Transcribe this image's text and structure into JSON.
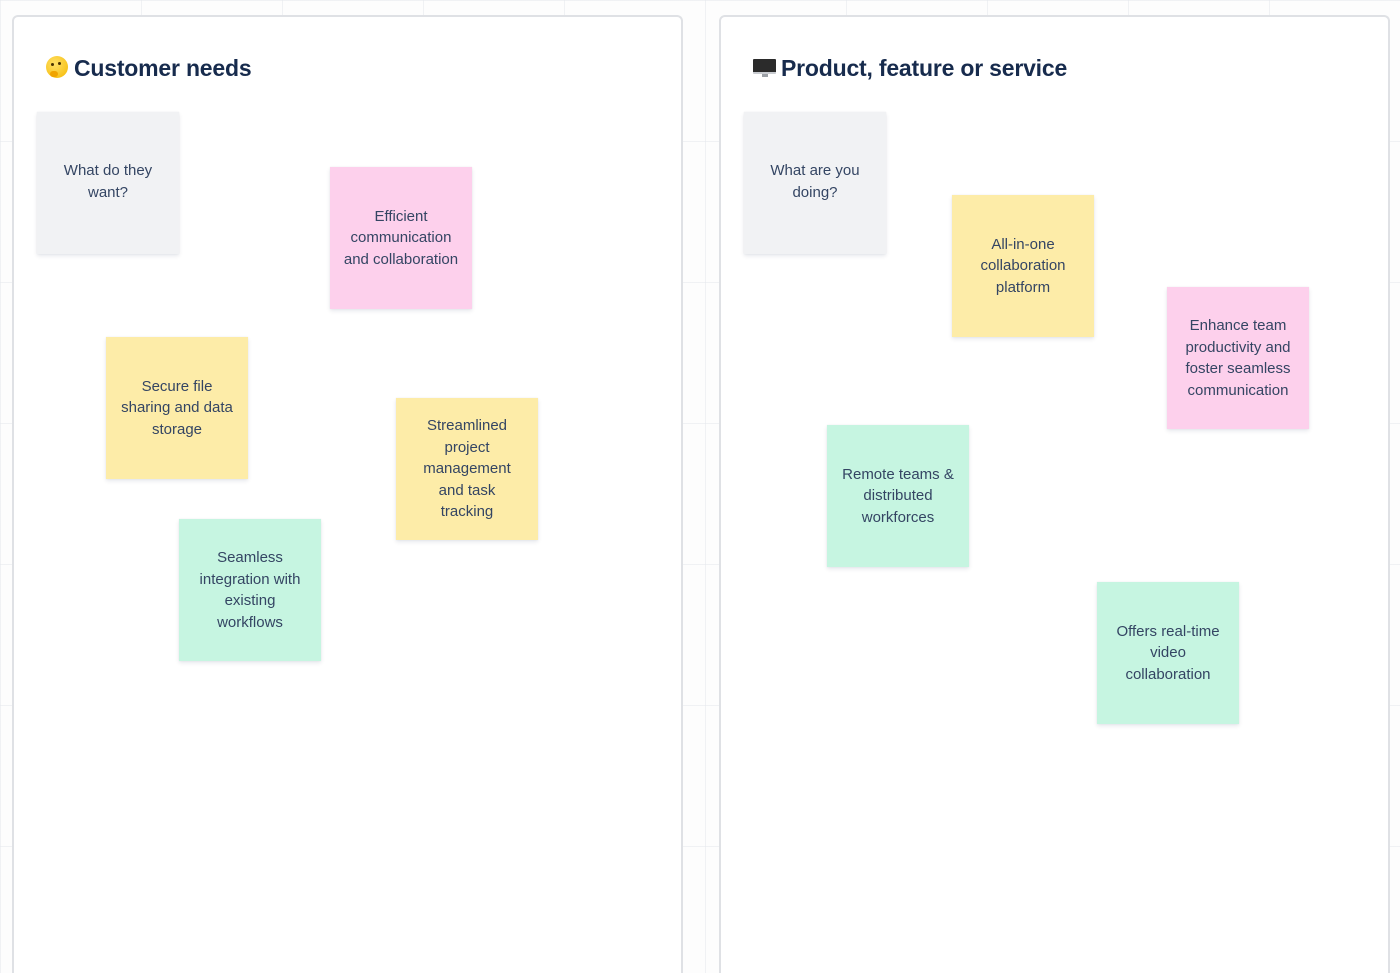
{
  "colors": {
    "gray": "#f1f2f4",
    "pink": "#fdd0ec",
    "yellow": "#fdeca8",
    "green": "#c6f5e1",
    "title_text": "#172b4d",
    "note_text": "#344563",
    "frame_border": "#dfe1e5"
  },
  "frames": [
    {
      "title": "Customer needs",
      "icon": "thinking-face-icon",
      "notes": [
        {
          "text": "What do they want?",
          "color": "gray"
        },
        {
          "text": "Efficient communication and collaboration",
          "color": "pink"
        },
        {
          "text": "Secure file sharing and data storage",
          "color": "yellow"
        },
        {
          "text": "Streamlined project management and task tracking",
          "color": "yellow"
        },
        {
          "text": "Seamless integration with existing workflows",
          "color": "green"
        }
      ]
    },
    {
      "title": "Product, feature or service",
      "icon": "desktop-computer-icon",
      "notes": [
        {
          "text": "What are you doing?",
          "color": "gray"
        },
        {
          "text": "All-in-one collaboration platform",
          "color": "yellow"
        },
        {
          "text": "Enhance team productivity and foster seamless communication",
          "color": "pink"
        },
        {
          "text": "Remote teams & distributed workforces",
          "color": "green"
        },
        {
          "text": "Offers real-time video collaboration",
          "color": "green"
        }
      ]
    }
  ]
}
